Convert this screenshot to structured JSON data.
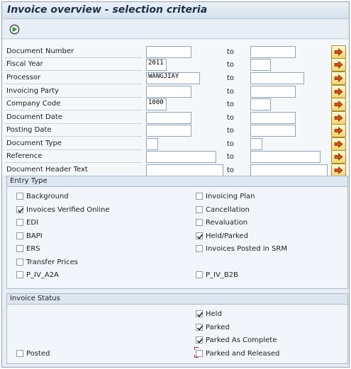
{
  "window": {
    "title": "Invoice overview - selection criteria"
  },
  "toolbar": {
    "execute_icon": "execute-clock-icon"
  },
  "fields": {
    "to_label": "to",
    "rows": [
      {
        "label": "Document Number",
        "from": "",
        "to": ""
      },
      {
        "label": "Fiscal Year",
        "from": "2011",
        "to": ""
      },
      {
        "label": "Processor",
        "from": "WANGJIAY",
        "to": ""
      },
      {
        "label": "Invoicing Party",
        "from": "",
        "to": ""
      },
      {
        "label": "Company Code",
        "from": "1000",
        "to": ""
      },
      {
        "label": "Document Date",
        "from": "",
        "to": ""
      },
      {
        "label": "Posting Date",
        "from": "",
        "to": ""
      },
      {
        "label": "Document Type",
        "from": "",
        "to": ""
      },
      {
        "label": "Reference",
        "from": "",
        "to": ""
      },
      {
        "label": "Document Header Text",
        "from": "",
        "to": ""
      }
    ]
  },
  "entry_type": {
    "title": "Entry Type",
    "items": [
      {
        "label": "Background",
        "checked": false
      },
      {
        "label": "Invoices Verified Online",
        "checked": true
      },
      {
        "label": "EDI",
        "checked": false
      },
      {
        "label": "BAPI",
        "checked": false
      },
      {
        "label": "ERS",
        "checked": false
      },
      {
        "label": "Transfer Prices",
        "checked": false
      },
      {
        "label": "P_IV_A2A",
        "checked": false
      },
      {
        "label": "Invoicing Plan",
        "checked": false
      },
      {
        "label": "Cancellation",
        "checked": false
      },
      {
        "label": "Revaluation",
        "checked": false
      },
      {
        "label": "Held/Parked",
        "checked": true
      },
      {
        "label": "Invoices Posted in SRM",
        "checked": false
      },
      {
        "label": "P_IV_B2B",
        "checked": false
      }
    ]
  },
  "invoice_status": {
    "title": "Invoice Status",
    "items": [
      {
        "label": "Held",
        "checked": true
      },
      {
        "label": "Parked",
        "checked": true
      },
      {
        "label": "Parked As Complete",
        "checked": true
      },
      {
        "label": "Parked and Released",
        "checked": false,
        "focused": true
      },
      {
        "label": "Posted",
        "checked": false
      }
    ]
  },
  "colors": {
    "title_text": "#1d2f45",
    "panel_bg": "#e7eef6",
    "field_border": "#8fa3b8",
    "more_button": "#f2d46e",
    "focus_marker": "#c21f1f"
  }
}
